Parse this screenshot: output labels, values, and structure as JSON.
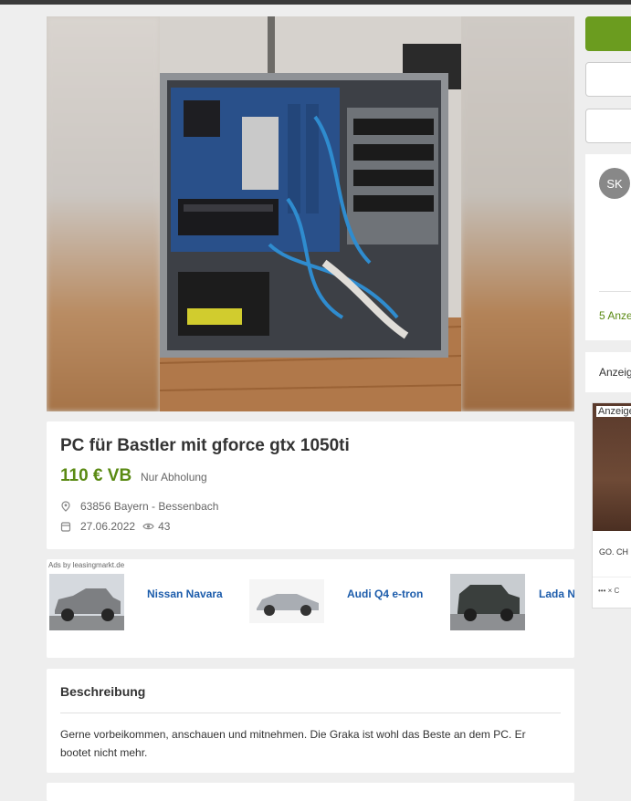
{
  "listing": {
    "title": "PC für Bastler mit gforce gtx 1050ti",
    "price": "110 € VB",
    "shipping": "Nur Abholung",
    "location": "63856 Bayern - Bessenbach",
    "date": "27.06.2022",
    "views": "43"
  },
  "ads": {
    "label": "Ads by leasingmarkt.de",
    "items": [
      {
        "name": "Nissan Navara"
      },
      {
        "name": "Audi Q4 e-tron"
      },
      {
        "name": "Lada N"
      }
    ]
  },
  "description": {
    "heading": "Beschreibung",
    "text": "Gerne vorbeikommen, anschauen und mitnehmen. Die Graka ist wohl das Beste an dem PC. Er bootet nicht mehr."
  },
  "seller": {
    "initials": "SK",
    "ads_count": "5 Anze"
  },
  "sidebar": {
    "report_label": "Anzeig",
    "ad_badge": "Anzeige",
    "ad_caption": "GO. CH",
    "ad_footer": "••• × C"
  },
  "colors": {
    "price": "#5a8a13",
    "primary_button": "#6b9c1f",
    "link": "#1c5cab"
  }
}
